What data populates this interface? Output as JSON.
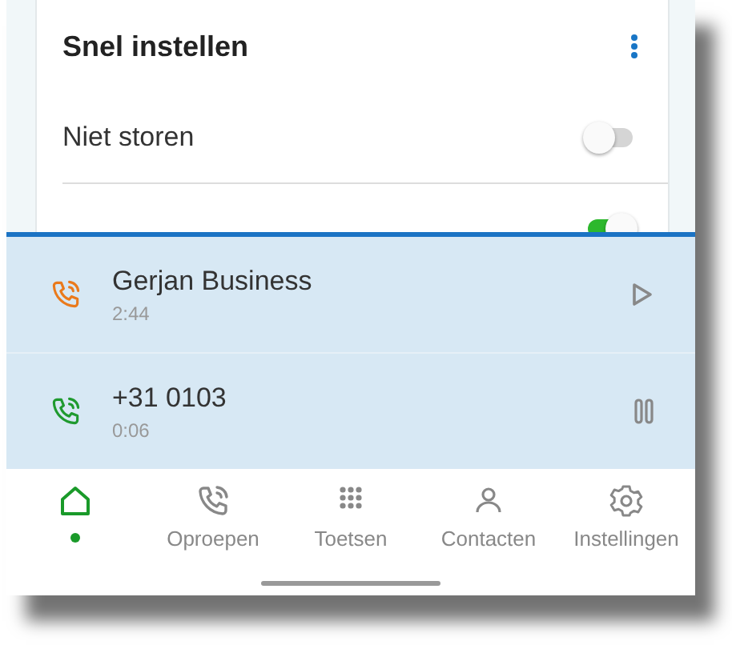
{
  "quick_settings": {
    "title": "Snel instellen",
    "items": [
      {
        "label": "Niet storen",
        "on": false
      },
      {
        "on": true
      }
    ]
  },
  "calls": [
    {
      "name": "Gerjan Business",
      "duration": "2:44",
      "kind": "held"
    },
    {
      "name": "+31 0103",
      "duration": "0:06",
      "kind": "active"
    }
  ],
  "nav": [
    {
      "kind": "home",
      "selected": true
    },
    {
      "kind": "calls",
      "label": "Oproepen",
      "selected": false
    },
    {
      "kind": "keypad",
      "label": "Toetsen",
      "selected": false
    },
    {
      "kind": "contacts",
      "label": "Contacten",
      "selected": false
    },
    {
      "kind": "settings",
      "label": "Instellingen",
      "selected": false
    }
  ]
}
